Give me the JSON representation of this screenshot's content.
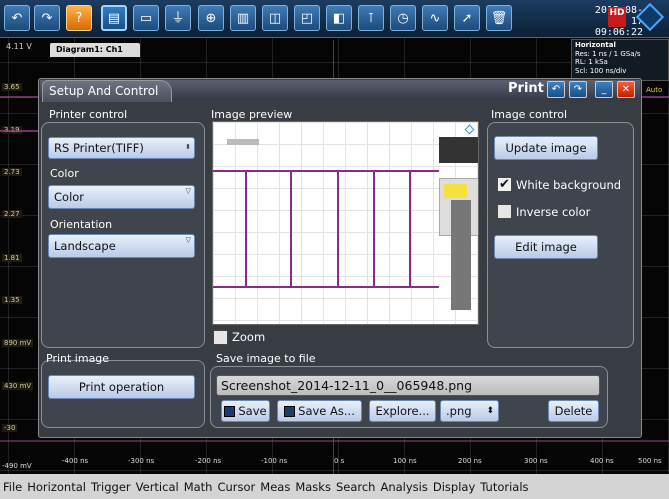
{
  "toolbar": {
    "datetime_date": "2015-08-17",
    "datetime_time": "09:06:22",
    "hd_badge": "HD",
    "buttons": [
      "undo-icon",
      "redo-icon",
      "help-icon",
      "screenshot-icon",
      "save-file-icon",
      "waveform-icon",
      "zoom-icon",
      "histogram-icon",
      "measure-icon",
      "cursor-icon",
      "marker-icon",
      "trigger-icon",
      "fft-icon",
      "pointer-icon",
      "delete-icon"
    ]
  },
  "scope": {
    "voltage_ch1": "4.11 V",
    "diagram_tab": "Diagram1: Ch1",
    "y_labels": [
      "3.65",
      "3.19",
      "2.73",
      "2.27",
      "1.81",
      "1.35",
      "890 mV",
      "430 mV",
      "-30"
    ],
    "x_labels": [
      "-490 mV",
      "-400 ns",
      "-300 ns",
      "-200 ns",
      "-100 ns",
      "0 s",
      "100 ns",
      "200 ns",
      "300 ns",
      "400 ns",
      "500 ns"
    ],
    "horizontal_info": [
      "Horizontal",
      "Res: 1 ns / 1 GSa/s",
      "RL: 1 kSa",
      "Scl: 100 ns/div"
    ],
    "auto": "Auto"
  },
  "panel": {
    "tab": "Setup And Control",
    "title": "Print",
    "printer_control": {
      "label": "Printer control",
      "printer": "RS Printer(TIFF)",
      "color_label": "Color",
      "color_value": "Color",
      "orientation_label": "Orientation",
      "orientation_value": "Landscape"
    },
    "image_preview": {
      "label": "Image preview",
      "zoom_label": "Zoom"
    },
    "image_control": {
      "label": "Image control",
      "update": "Update image",
      "white_bg": "White background",
      "inverse": "Inverse color",
      "edit": "Edit image",
      "white_bg_checked": true,
      "inverse_checked": false
    },
    "print_image": {
      "label": "Print image",
      "button": "Print operation"
    },
    "save": {
      "label": "Save image to file",
      "filename": "Screenshot_2014-12-11_0__065948.png",
      "save": "Save",
      "save_as": "Save As...",
      "explore": "Explore...",
      "format": ".png",
      "delete": "Delete"
    }
  },
  "menubar": [
    "File",
    "Horizontal",
    "Trigger",
    "Vertical",
    "Math",
    "Cursor",
    "Meas",
    "Masks",
    "Search",
    "Analysis",
    "Display",
    "Tutorials"
  ]
}
